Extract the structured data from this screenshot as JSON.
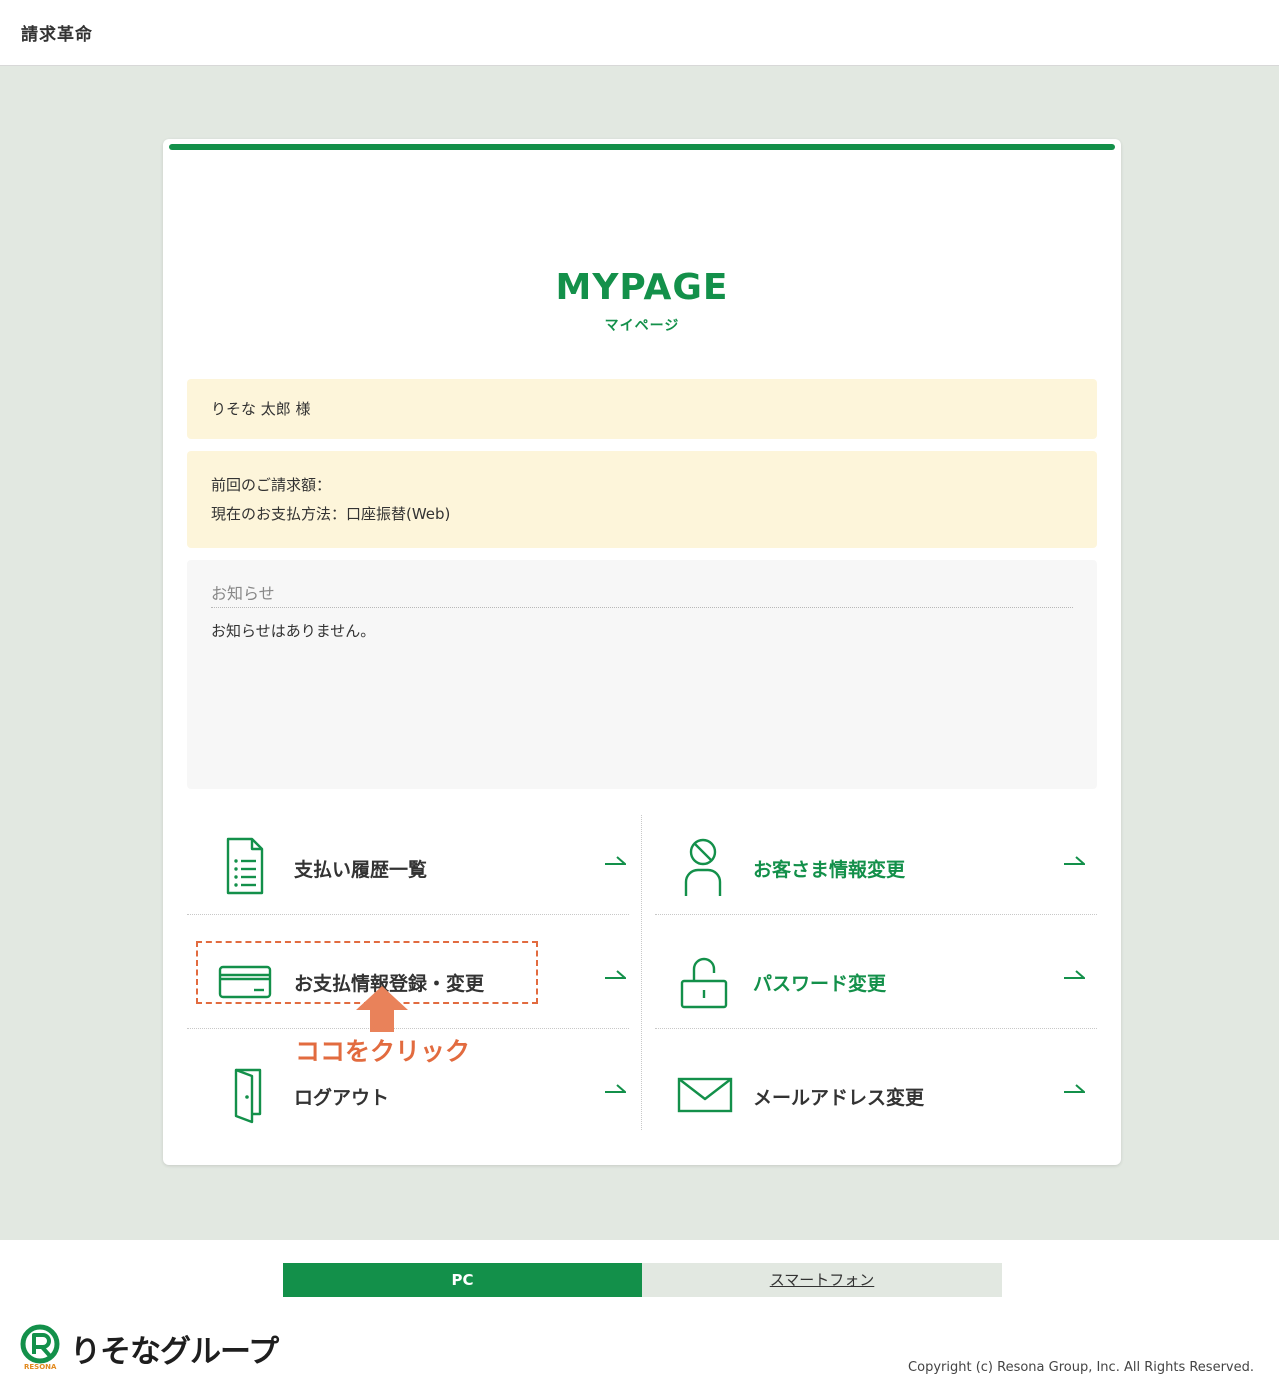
{
  "header": {
    "brand": "請求革命"
  },
  "page": {
    "title": "MYPAGE",
    "subtitle": "マイページ"
  },
  "user": {
    "greeting": "りそな 太郎 様"
  },
  "billing": {
    "last_amount": "前回のご請求額：",
    "payment_method": "現在のお支払方法：口座振替(Web)"
  },
  "news": {
    "heading": "お知らせ",
    "body": "お知らせはありません。"
  },
  "menu": {
    "payment_history": "支払い履歴一覧",
    "customer_info": "お客さま情報変更",
    "payment_register": "お支払情報登録・変更",
    "password": "パスワード変更",
    "logout": "ログアウト",
    "email": "メールアドレス変更"
  },
  "annotation": {
    "click_here": "ココをクリック"
  },
  "footer": {
    "pc": "PC",
    "smartphone": "スマートフォン",
    "logo_text": "りそなグループ",
    "logo_caption": "RESONA",
    "copyright": "Copyright (c) Resona Group, Inc. All Rights Reserved."
  },
  "colors": {
    "accent": "#13904a",
    "highlight": "#e26b3f",
    "notice_bg": "#fdf5da",
    "page_bg": "#e2e8e1"
  }
}
